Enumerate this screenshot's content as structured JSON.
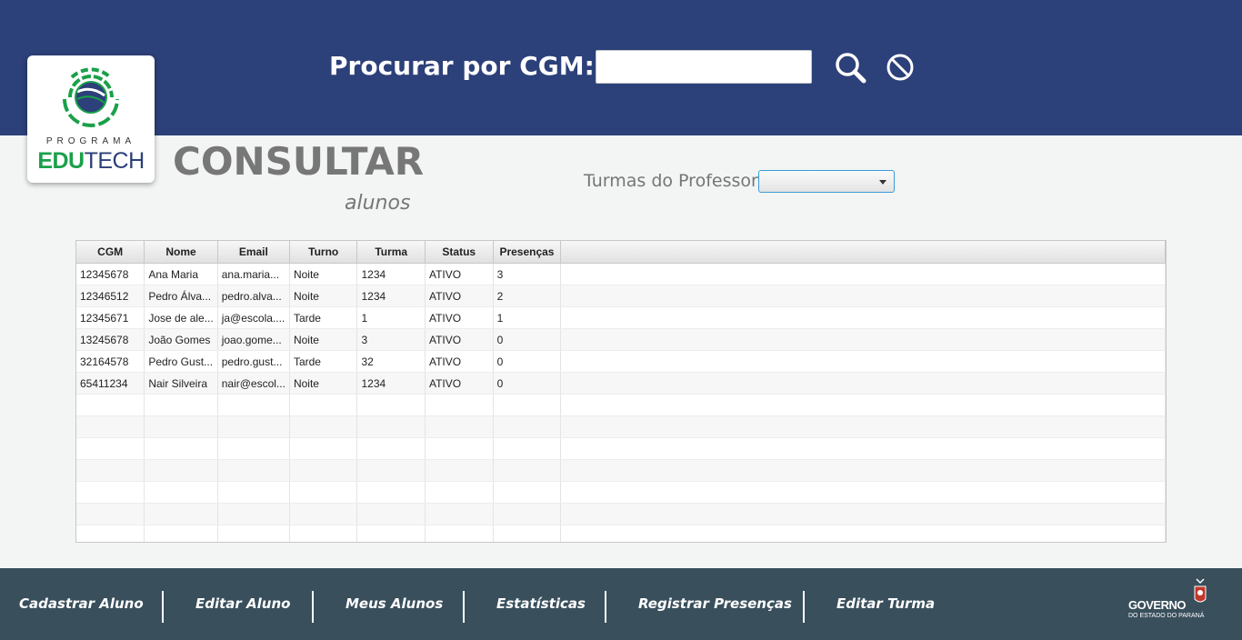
{
  "header": {
    "search_label": "Procurar por CGM:",
    "search_value": "",
    "search_placeholder": ""
  },
  "logo": {
    "line1": "PROGRAMA",
    "edu": "EDU",
    "tech": "TECH"
  },
  "page": {
    "title": "CONSULTAR",
    "subtitle": "alunos",
    "turmas_label": "Turmas do Professor:",
    "turmas_selected": ""
  },
  "table": {
    "columns": [
      "CGM",
      "Nome",
      "Email",
      "Turno",
      "Turma",
      "Status",
      "Presenças"
    ],
    "rows": [
      [
        "12345678",
        "Ana Maria",
        "ana.maria...",
        "Noite",
        "1234",
        "ATIVO",
        "3"
      ],
      [
        "12346512",
        "Pedro Álva...",
        "pedro.alva...",
        "Noite",
        "1234",
        "ATIVO",
        "2"
      ],
      [
        "12345671",
        "Jose de ale...",
        "ja@escola....",
        "Tarde",
        "1",
        "ATIVO",
        "1"
      ],
      [
        "13245678",
        "João Gomes",
        "joao.gome...",
        "Noite",
        "3",
        "ATIVO",
        "0"
      ],
      [
        "32164578",
        "Pedro Gust...",
        "pedro.gust...",
        "Tarde",
        "32",
        "ATIVO",
        "0"
      ],
      [
        "65411234",
        "Nair Silveira",
        "nair@escol...",
        "Noite",
        "1234",
        "ATIVO",
        "0"
      ],
      [
        "",
        "",
        "",
        "",
        "",
        "",
        ""
      ],
      [
        "",
        "",
        "",
        "",
        "",
        "",
        ""
      ],
      [
        "",
        "",
        "",
        "",
        "",
        "",
        ""
      ],
      [
        "",
        "",
        "",
        "",
        "",
        "",
        ""
      ],
      [
        "",
        "",
        "",
        "",
        "",
        "",
        ""
      ],
      [
        "",
        "",
        "",
        "",
        "",
        "",
        ""
      ],
      [
        "",
        "",
        "",
        "",
        "",
        "",
        ""
      ]
    ]
  },
  "footer": {
    "nav": [
      "Cadastrar Aluno",
      "Editar Aluno",
      "Meus Alunos",
      "Estatísticas",
      "Registrar Presenças",
      "Editar Turma"
    ],
    "gov_name": "GOVERNO",
    "gov_sub": "DO ESTADO DO PARANÁ"
  },
  "colors": {
    "header_bg": "#2c4079",
    "footer_bg": "#394f5c",
    "page_bg": "#f2f5f4",
    "edu_green": "#1aa04a",
    "tech_blue": "#2c4079"
  },
  "icons": {
    "search": "search-icon",
    "clear": "cancel-icon",
    "dropdown": "chevron-down-icon"
  }
}
